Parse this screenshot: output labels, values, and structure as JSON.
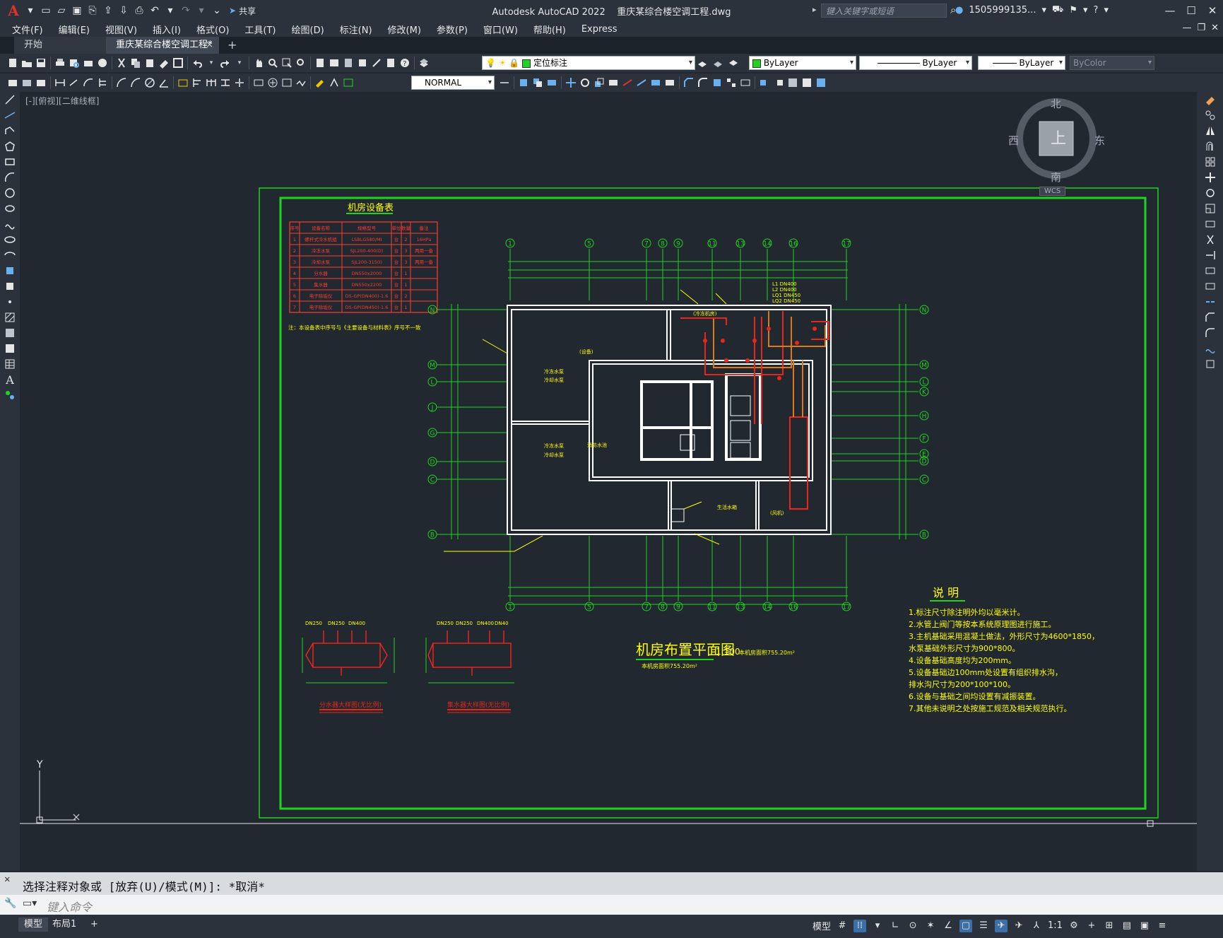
{
  "titlebar": {
    "app_title": "Autodesk AutoCAD 2022",
    "filename": "重庆某综合楼空调工程.dwg",
    "share_label": "共享",
    "search_placeholder": "键入关键字或短语",
    "user": "1505999135...",
    "logo_letter": "A"
  },
  "menu": [
    "文件(F)",
    "编辑(E)",
    "视图(V)",
    "插入(I)",
    "格式(O)",
    "工具(T)",
    "绘图(D)",
    "标注(N)",
    "修改(M)",
    "参数(P)",
    "窗口(W)",
    "帮助(H)",
    "Express"
  ],
  "tabs": {
    "start": "开始",
    "active": "重庆某综合楼空调工程*",
    "close": "×",
    "add": "+"
  },
  "layer_toolbar": {
    "layer_name": "定位标注",
    "color": "ByLayer",
    "linetype": "ByLayer",
    "lineweight": "ByLayer",
    "plotstyle": "ByColor"
  },
  "style_toolbar": {
    "dimstyle": "NORMAL"
  },
  "viewport": {
    "label": "[-][俯视][二维线框]"
  },
  "viewcube": {
    "top": "上",
    "north": "北",
    "south": "南",
    "east": "东",
    "west": "西",
    "wcs": "WCS"
  },
  "ucs": {
    "y": "Y",
    "x": "X"
  },
  "drawing": {
    "equip_title": "机房设备表",
    "equip_headers": [
      "序号",
      "设备名称",
      "规格型号",
      "单位",
      "数量",
      "备注"
    ],
    "equip_rows": [
      [
        "1",
        "螺杆式冷水机组",
        "LSBLG580/MI",
        "台",
        "2",
        "16HPa"
      ],
      [
        "2",
        "冷冻水泵",
        "SJL200-400(D)",
        "台",
        "3",
        "两用一备"
      ],
      [
        "3",
        "冷却水泵",
        "SJL200-315(I)",
        "台",
        "3",
        "两用一备"
      ],
      [
        "4",
        "分水器",
        "DN550x2000",
        "台",
        "1",
        ""
      ],
      [
        "5",
        "集水器",
        "DN550x2200",
        "台",
        "1",
        ""
      ],
      [
        "6",
        "电子除垢仪",
        "DS-GP(DN400)-1.6",
        "台",
        "2",
        ""
      ],
      [
        "7",
        "电子除垢仪",
        "DS-GP(DN450)-1.6",
        "台",
        "1",
        ""
      ]
    ],
    "equip_note": "注：本设备表中序号与《主要设备与材料表》序号不一致",
    "axis_top": [
      "1",
      "5",
      "7",
      "8",
      "9",
      "11",
      "13",
      "14",
      "16",
      "17"
    ],
    "axis_left": [
      "N",
      "M",
      "L",
      "J",
      "G",
      "D",
      "C",
      "B"
    ],
    "axis_right": [
      "N",
      "M",
      "L",
      "K",
      "H",
      "F",
      "E",
      "D",
      "C",
      "B"
    ],
    "pipe_labels": [
      "L1  DN400",
      "L2  DN400",
      "LQ1 DN450",
      "LQ2 DN450"
    ],
    "room_labels": [
      "(冷冻机房)",
      "冷冻水泵",
      "冷却水泵",
      "冷冻水泵",
      "冷却水泵",
      "(设备)",
      "生活水箱",
      "(风机)",
      "消防水池"
    ],
    "plan_title": "机房布置平面图",
    "plan_scale": "1:100",
    "plan_area": "本机房面积755.20m²",
    "plan_area2": "本机房面积755.20m²",
    "detail1_caption": "分水器大样图(无比例)",
    "detail2_caption": "集水器大样图(无比例)",
    "detail1_pipes": [
      "DN250",
      "DN250",
      "DN400"
    ],
    "detail2_pipes": [
      "DN250",
      "DN250",
      "DN400",
      "DN40"
    ],
    "notes_title": "说  明",
    "notes": [
      "1.标注尺寸除注明外均以毫米计。",
      "2.水管上阀门等按本系统原理图进行施工。",
      "3.主机基础采用混凝土做法，外形尺寸为4600*1850，",
      "  水泵基础外形尺寸为900*800。",
      "4.设备基础高度均为200mm。",
      "5.设备基础边100mm处设置有组织排水沟，",
      "  排水沟尺寸为200*100*100。",
      "6.设备与基础之间均设置有减振装置。",
      "7.其他未说明之处按施工规范及相关规范执行。"
    ]
  },
  "command": {
    "history": "选择注释对象或 [放弃(U)/模式(M)]: *取消*",
    "placeholder": "键入命令"
  },
  "status": {
    "model_tab": "模型",
    "layout_tab": "布局1",
    "add_tab": "+",
    "mode_label": "模型",
    "scale": "1:1"
  },
  "colors": {
    "border": "#1fd41f",
    "axis": "#1fd41f",
    "wall": "#ffffff",
    "text_yellow": "#ffff00",
    "table_red": "#ff3b2f",
    "pipe_red": "#e8261c",
    "pipe_orange": "#e07a18"
  }
}
